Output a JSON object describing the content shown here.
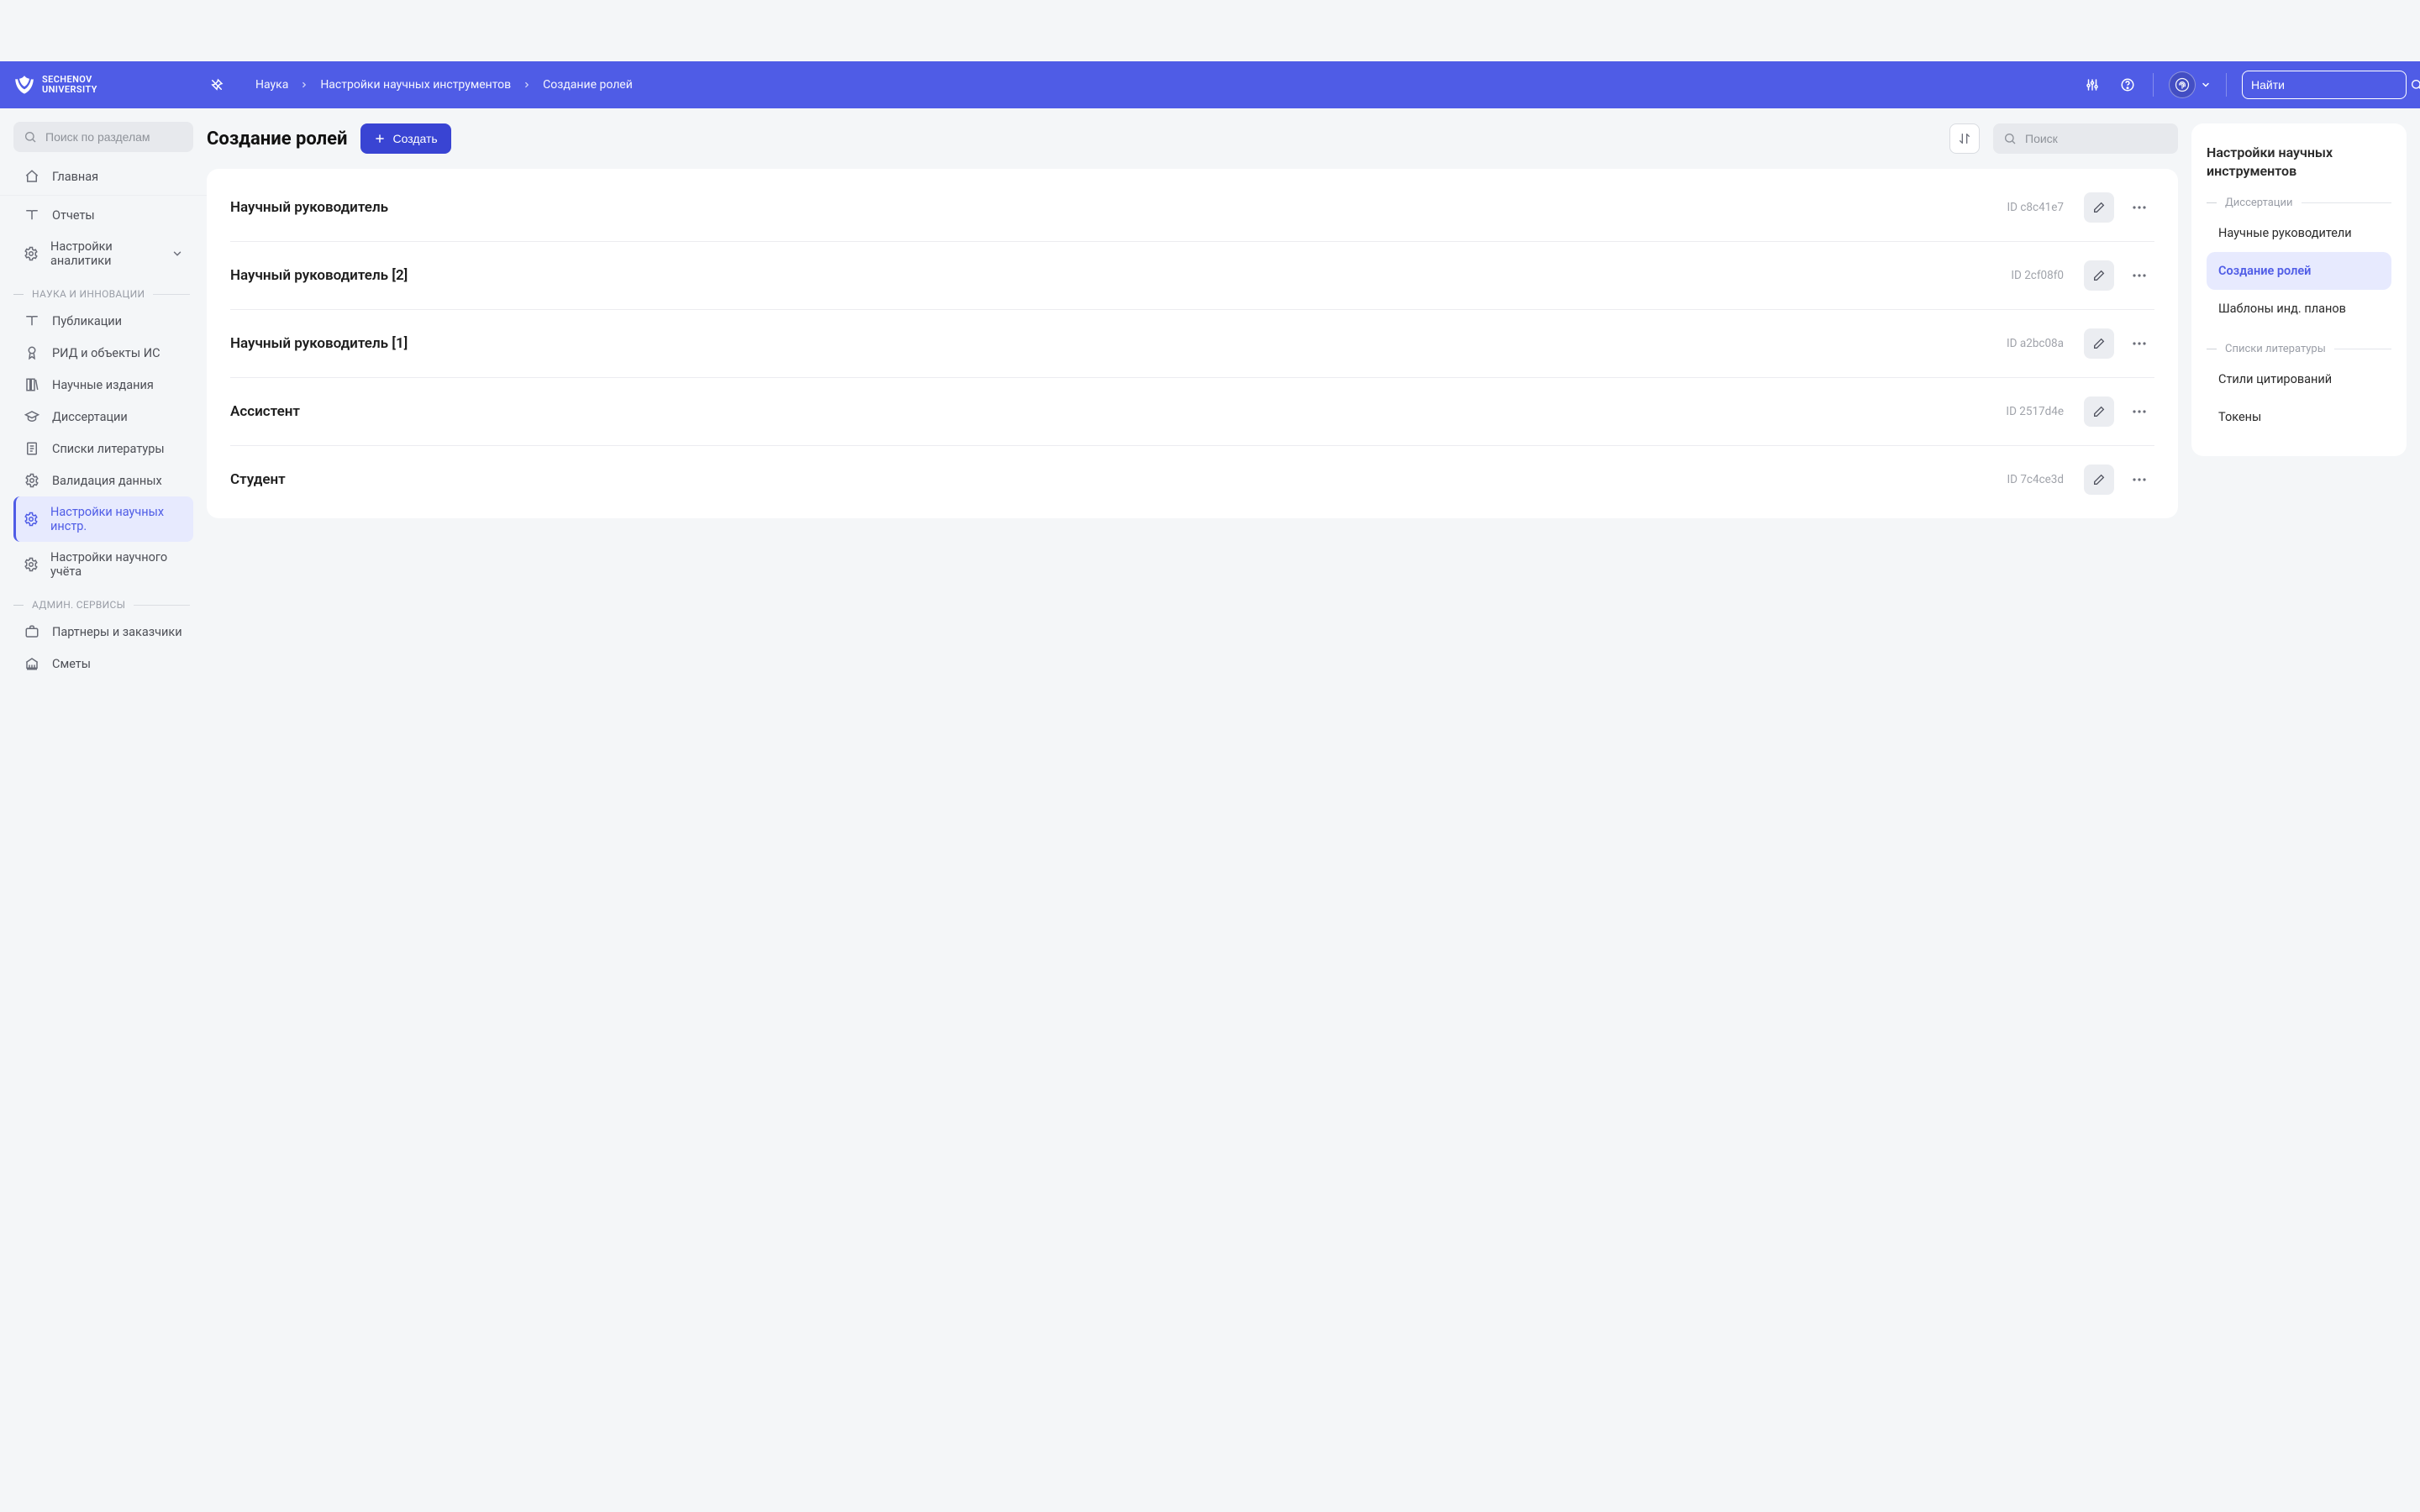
{
  "brand": {
    "name1": "SECHENOV",
    "name2": "UNIVERSITY"
  },
  "header": {
    "breadcrumbs": [
      "Наука",
      "Настройки научных инструментов",
      "Создание ролей"
    ],
    "search_placeholder": "Найти"
  },
  "sidebar": {
    "search_placeholder": "Поиск по разделам",
    "top_items": [
      {
        "label": "Главная"
      },
      {
        "label": "Отчеты"
      },
      {
        "label": "Настройки аналитики",
        "chevron": true
      }
    ],
    "sections": [
      {
        "label": "Наука и инновации",
        "items": [
          {
            "label": "Публикации",
            "icon": "book"
          },
          {
            "label": "РИД и объекты ИС",
            "icon": "award"
          },
          {
            "label": "Научные издания",
            "icon": "journals"
          },
          {
            "label": "Диссертации",
            "icon": "cap"
          },
          {
            "label": "Списки литературы",
            "icon": "list-doc"
          },
          {
            "label": "Валидация данных",
            "icon": "gear"
          },
          {
            "label": "Настройки научных инстр.",
            "icon": "gear",
            "active": true
          },
          {
            "label": "Настройки научного учёта",
            "icon": "gear"
          }
        ]
      },
      {
        "label": "Админ. сервисы",
        "items": [
          {
            "label": "Партнеры и заказчики",
            "icon": "briefcase"
          },
          {
            "label": "Сметы",
            "icon": "bank"
          }
        ]
      }
    ]
  },
  "main": {
    "title": "Создание ролей",
    "create_label": "Создать",
    "list_search_placeholder": "Поиск",
    "rows": [
      {
        "title": "Научный руководитель",
        "id": "ID c8c41e7"
      },
      {
        "title": "Научный руководитель [2]",
        "id": "ID 2cf08f0"
      },
      {
        "title": "Научный руководитель [1]",
        "id": "ID a2bc08a"
      },
      {
        "title": "Ассистент",
        "id": "ID 2517d4e"
      },
      {
        "title": "Студент",
        "id": "ID 7c4ce3d"
      }
    ]
  },
  "right": {
    "title": "Настройки научных инструментов",
    "groups": [
      {
        "label": "Диссертации",
        "items": [
          {
            "label": "Научные руководители"
          },
          {
            "label": "Создание ролей",
            "active": true
          },
          {
            "label": "Шаблоны инд. планов"
          }
        ]
      },
      {
        "label": "Списки литературы",
        "items": [
          {
            "label": "Стили цитирований"
          },
          {
            "label": "Токены"
          }
        ]
      }
    ]
  }
}
